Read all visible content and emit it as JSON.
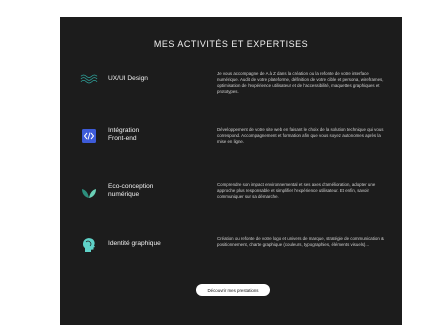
{
  "section": {
    "title": "MES ACTIVITÉS ET EXPERTISES"
  },
  "services": [
    {
      "label": "UX/UI Design",
      "icon": "wave-lines-icon",
      "description": "Je vous accompagne de A à Z dans la création ou la refonte de votre interface numérique. Audit de votre plateforme, définition de votre cible et persona, wireframes, optimisation de l'expérience utilisateur et de l'accessibilité, maquettes graphiques et prototypes."
    },
    {
      "label": "Intégration\nFront-end",
      "icon": "code-brackets-icon",
      "description": "Développement de votre site web en faisant le choix de la solution technique qui vous correspond. Accompagnement et formation afin que vous soyez autonomes après la mise en ligne."
    },
    {
      "label": "Eco-conception\nnumérique",
      "icon": "leaf-icon",
      "description": "Comprendre son impact environnemental et ses axes d'amélioration, adopter une approche plus responsable et simplifier l'expérience utilisateur. Et enfin, savoir communiquer sur sa démarche."
    },
    {
      "label": "Identité graphique",
      "icon": "head-profile-icon",
      "description": "Création ou refonte de votre logo et univers de marque, stratégie de communication & positionnement, charte graphique (couleurs, typographies, éléments visuels)..."
    }
  ],
  "cta": {
    "label": "Découvrir mes prestations"
  },
  "colors": {
    "panel_bg": "#1c1c1c",
    "accent_teal": "#5fd2c8",
    "accent_blue": "#3d5bd9",
    "cta_bg": "#ffffff"
  }
}
